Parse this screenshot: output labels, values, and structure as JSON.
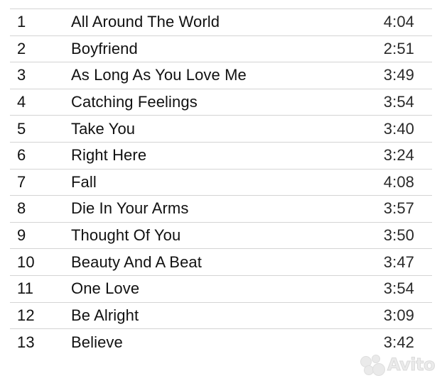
{
  "tracks": [
    {
      "number": "1",
      "title": "All Around The World",
      "duration": "4:04"
    },
    {
      "number": "2",
      "title": "Boyfriend",
      "duration": "2:51"
    },
    {
      "number": "3",
      "title": "As Long As You Love Me",
      "duration": "3:49"
    },
    {
      "number": "4",
      "title": "Catching Feelings",
      "duration": "3:54"
    },
    {
      "number": "5",
      "title": "Take You",
      "duration": "3:40"
    },
    {
      "number": "6",
      "title": "Right Here",
      "duration": "3:24"
    },
    {
      "number": "7",
      "title": "Fall",
      "duration": "4:08"
    },
    {
      "number": "8",
      "title": "Die In Your Arms",
      "duration": "3:57"
    },
    {
      "number": "9",
      "title": "Thought Of You",
      "duration": "3:50"
    },
    {
      "number": "10",
      "title": "Beauty And A Beat",
      "duration": "3:47"
    },
    {
      "number": "11",
      "title": "One Love",
      "duration": "3:54"
    },
    {
      "number": "12",
      "title": "Be Alright",
      "duration": "3:09"
    },
    {
      "number": "13",
      "title": "Believe",
      "duration": "3:42"
    }
  ],
  "watermark": {
    "text": "Avito",
    "icon": "avito-logo-icon"
  }
}
